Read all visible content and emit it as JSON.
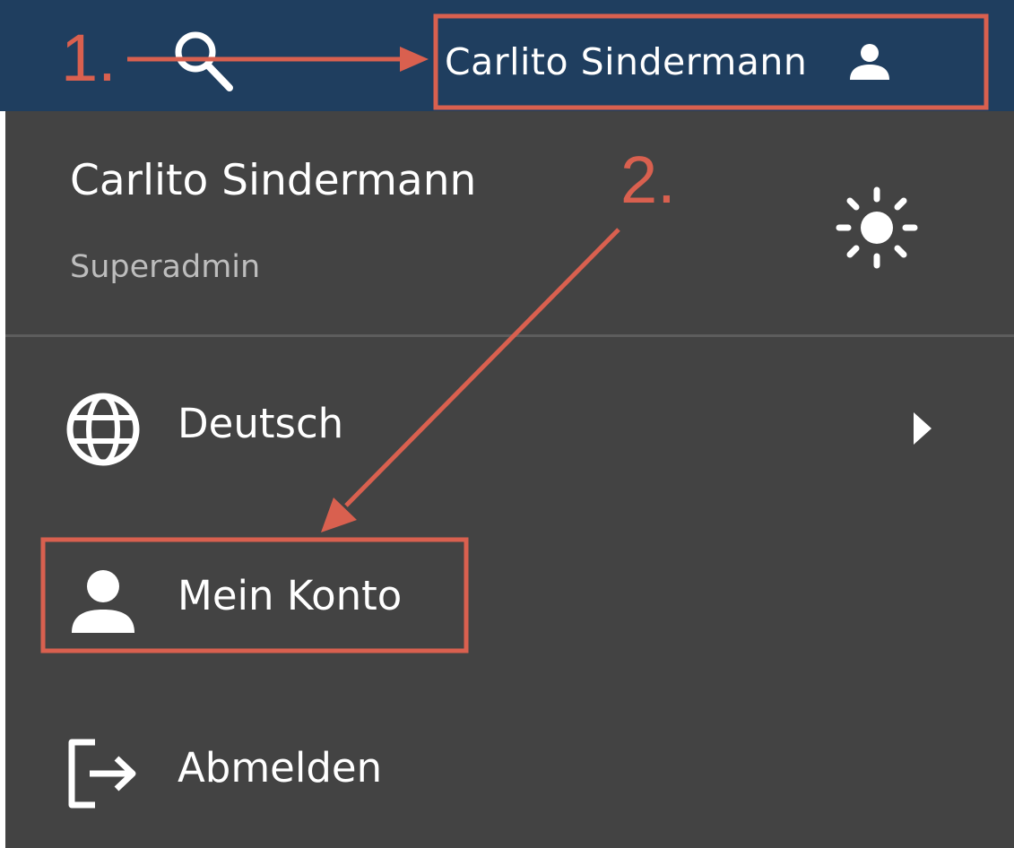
{
  "topbar": {
    "user_name": "Carlito Sindermann",
    "search_icon": "search-icon",
    "user_icon": "person-icon",
    "bg_color": "#1f3e5f"
  },
  "user_menu": {
    "name": "Carlito Sindermann",
    "role": "Superadmin",
    "theme_icon": "sun-icon",
    "bg_color": "#434343",
    "items": [
      {
        "label": "Deutsch",
        "icon": "globe-icon",
        "trailing_icon": "chevron-right-icon"
      },
      {
        "label": "Mein Konto",
        "icon": "person-icon"
      },
      {
        "label": "Abmelden",
        "icon": "logout-icon"
      }
    ]
  },
  "annotations": {
    "color": "#d9604f",
    "step1": "1.",
    "step2": "2."
  }
}
